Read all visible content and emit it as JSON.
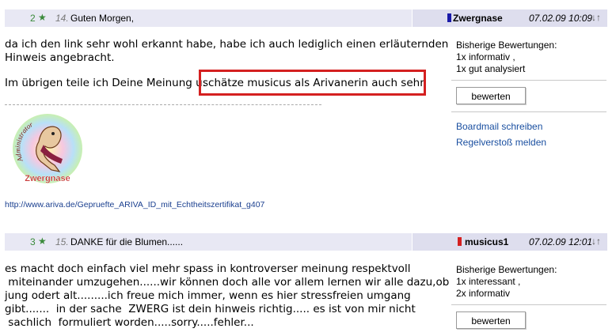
{
  "posts": [
    {
      "rating_count": "2",
      "index": "14.",
      "title": "Guten Morgen,",
      "author": "Zwergnase",
      "date": "07.02.09 10:09",
      "arrows": "↓↑",
      "body_lines": [
        "da ich den link sehr wohl erkannt habe, habe ich auch lediglich einen erläuternden",
        "Hinweis angebracht.",
        "Im übrigen teile ich Deine Meinung u.",
        "schätze musicus als Arivanerin auch sehr."
      ],
      "ratings_title": "Bisherige Bewertungen:",
      "ratings": [
        "1x informativ ,",
        "1x gut analysiert"
      ],
      "rate_button": "bewerten",
      "boardmail_link": "Boardmail schreiben",
      "report_link": "Regelverstoß melden",
      "avatar_caption": "Zwergnase",
      "avatar_arc_text": "Administrator",
      "signature_link": "http://www.ariva.de/Gepruefte_ARIVA_ID_mit_Echtheitszertifikat_g407",
      "author_mark_color": "#1a1aa8"
    },
    {
      "rating_count": "3",
      "index": "15.",
      "title": "DANKE für die Blumen......",
      "author": "musicus1",
      "date": "07.02.09 12:01",
      "arrows": "↓↑",
      "body_lines": [
        "es macht doch einfach  viel mehr spass in kontroverser meinung  respektvoll",
        " miteinander umzugehen......wir können doch alle vor allem lernen wir alle dazu,ob",
        "jung odert alt.........ich freue mich immer, wenn es hier stressfreien umgang",
        "gibt.......  in der sache  ZWERG ist dein hinweis richtig..... es ist von mir nicht",
        " sachlich  formuliert worden.....sorry.....fehler..."
      ],
      "ratings_title": "Bisherige Bewertungen:",
      "ratings": [
        "1x interessant ,",
        "2x informativ"
      ],
      "rate_button": "bewerten",
      "author_mark_color": "#d42020"
    }
  ],
  "colors": {
    "header_bg": "#e8e8f4",
    "star_green": "#3a8a3a",
    "link_blue": "#1a4fa0",
    "highlight_red": "#d42020"
  }
}
